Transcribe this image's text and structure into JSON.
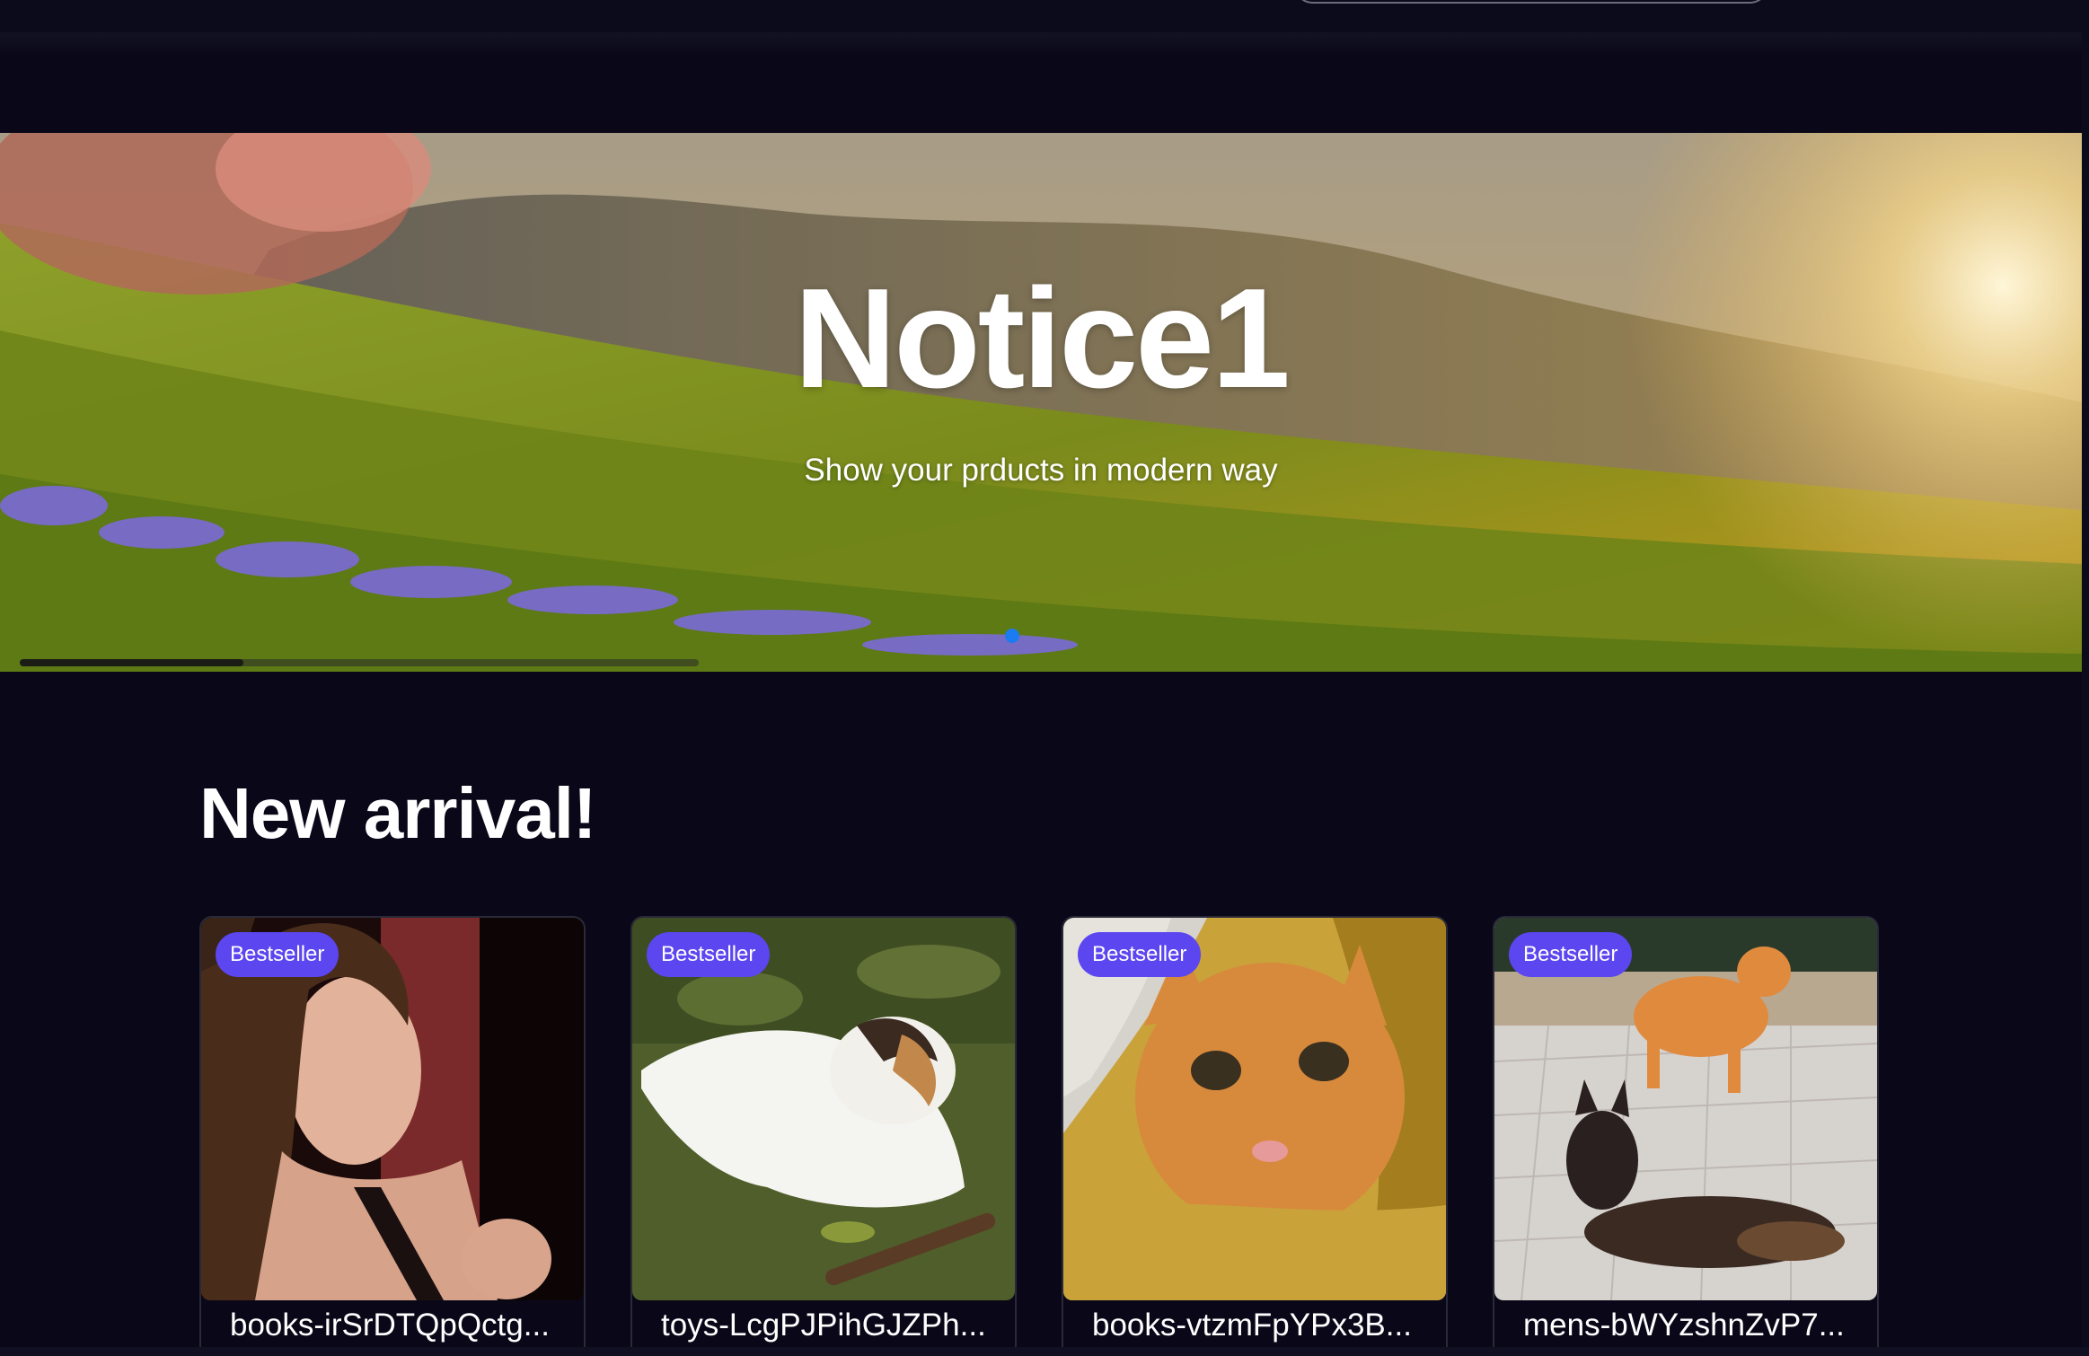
{
  "hero": {
    "title": "Notice1",
    "subtitle": "Show your prducts in modern way",
    "slide_progress": 0.33,
    "active_slide": 1
  },
  "new_arrivals": {
    "title": "New arrival!",
    "products": [
      {
        "badge": "Bestseller",
        "name": "books-irSrDTQpQctg..."
      },
      {
        "badge": "Bestseller",
        "name": "toys-LcgPJPihGJZPh..."
      },
      {
        "badge": "Bestseller",
        "name": "books-vtzmFpYPx3B..."
      },
      {
        "badge": "Bestseller",
        "name": "mens-bWYzshnZvP7..."
      }
    ]
  },
  "colors": {
    "background": "#0a0818",
    "badge": "#5b46f0",
    "carousel_dot": "#1a7cf0"
  }
}
